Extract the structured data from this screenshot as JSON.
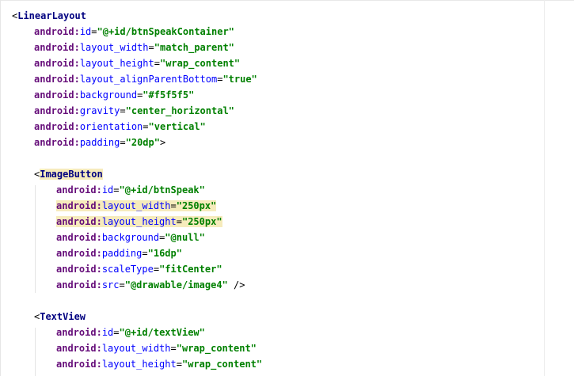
{
  "editor": {
    "lines": [
      {
        "indent": 0,
        "open": "<",
        "tag": "LinearLayout"
      },
      {
        "indent": 1,
        "ns": "android",
        "colon": ":",
        "attr": "id",
        "eq": "=",
        "value": "\"@+id/btnSpeakContainer\""
      },
      {
        "indent": 1,
        "ns": "android",
        "colon": ":",
        "attr": "layout_width",
        "eq": "=",
        "value": "\"match_parent\""
      },
      {
        "indent": 1,
        "ns": "android",
        "colon": ":",
        "attr": "layout_height",
        "eq": "=",
        "value": "\"wrap_content\""
      },
      {
        "indent": 1,
        "ns": "android",
        "colon": ":",
        "attr": "layout_alignParentBottom",
        "eq": "=",
        "value": "\"true\""
      },
      {
        "indent": 1,
        "ns": "android",
        "colon": ":",
        "attr": "background",
        "eq": "=",
        "value": "\"#f5f5f5\""
      },
      {
        "indent": 1,
        "ns": "android",
        "colon": ":",
        "attr": "gravity",
        "eq": "=",
        "value": "\"center_horizontal\""
      },
      {
        "indent": 1,
        "ns": "android",
        "colon": ":",
        "attr": "orientation",
        "eq": "=",
        "value": "\"vertical\""
      },
      {
        "indent": 1,
        "ns": "android",
        "colon": ":",
        "attr": "padding",
        "eq": "=",
        "value": "\"20dp\"",
        "close": ">"
      },
      {
        "blank": true
      },
      {
        "indent": 1,
        "open": "<",
        "tag": "ImageButton",
        "highlight": true
      },
      {
        "indent": 2,
        "ns": "android",
        "colon": ":",
        "attr": "id",
        "eq": "=",
        "value": "\"@+id/btnSpeak\""
      },
      {
        "indent": 2,
        "ns": "android",
        "colon": ":",
        "attr": "layout_width",
        "eq": "=",
        "value": "\"250px\"",
        "highlight": true
      },
      {
        "indent": 2,
        "ns": "android",
        "colon": ":",
        "attr": "layout_height",
        "eq": "=",
        "value": "\"250px\"",
        "highlight": true
      },
      {
        "indent": 2,
        "ns": "android",
        "colon": ":",
        "attr": "background",
        "eq": "=",
        "value": "\"@null\""
      },
      {
        "indent": 2,
        "ns": "android",
        "colon": ":",
        "attr": "padding",
        "eq": "=",
        "value": "\"16dp\""
      },
      {
        "indent": 2,
        "ns": "android",
        "colon": ":",
        "attr": "scaleType",
        "eq": "=",
        "value": "\"fitCenter\""
      },
      {
        "indent": 2,
        "ns": "android",
        "colon": ":",
        "attr": "src",
        "eq": "=",
        "value": "\"@drawable/image4\"",
        "close": " />"
      },
      {
        "blank": true
      },
      {
        "indent": 1,
        "open": "<",
        "tag": "TextView"
      },
      {
        "indent": 2,
        "ns": "android",
        "colon": ":",
        "attr": "id",
        "eq": "=",
        "value": "\"@+id/textView\""
      },
      {
        "indent": 2,
        "ns": "android",
        "colon": ":",
        "attr": "layout_width",
        "eq": "=",
        "value": "\"wrap_content\""
      },
      {
        "indent": 2,
        "ns": "android",
        "colon": ":",
        "attr": "layout_height",
        "eq": "=",
        "value": "\"wrap_content\""
      }
    ]
  }
}
